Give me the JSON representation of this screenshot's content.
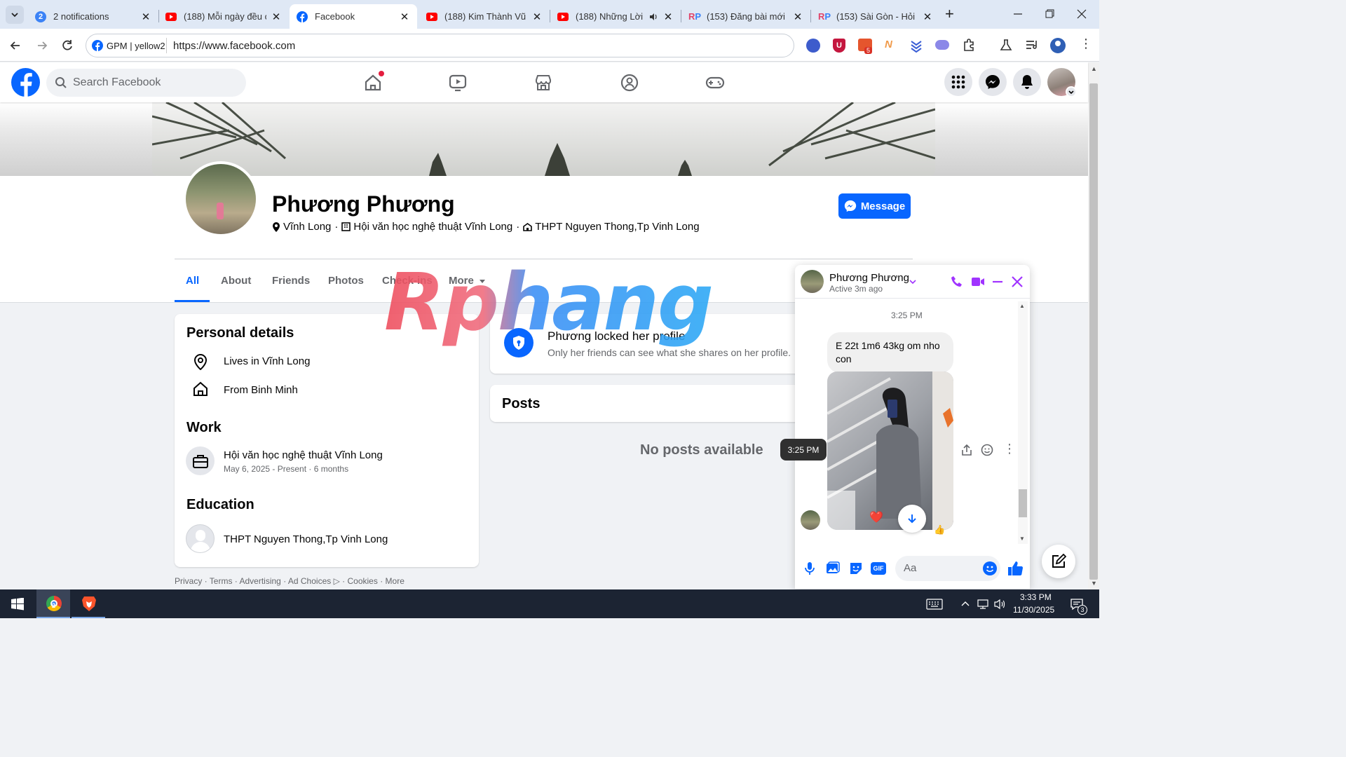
{
  "browser": {
    "tabs": [
      {
        "title": "2 notifications",
        "icon": "notification-badge-icon"
      },
      {
        "title": "(188) Mỗi ngày đều c",
        "icon": "youtube-icon"
      },
      {
        "title": "Facebook",
        "icon": "facebook-icon",
        "active": true
      },
      {
        "title": "(188) Kim Thành Vũ ·",
        "icon": "youtube-icon"
      },
      {
        "title": "(188) Những Lời",
        "icon": "youtube-icon"
      },
      {
        "title": "(153) Đăng bài mới |",
        "icon": "rp-icon"
      },
      {
        "title": "(153) Sài Gòn - Hỏi ·",
        "icon": "rp-icon"
      }
    ],
    "tab_badge": "2",
    "profile_chip": "GPM | yellow2",
    "url": "https://www.facebook.com",
    "extension_badge": "5"
  },
  "fb": {
    "search_placeholder": "Search Facebook",
    "profile": {
      "name": "Phương Phương",
      "location": "Vĩnh Long",
      "work_short": "Hội văn học nghệ thuật Vĩnh Long",
      "school_short": "THPT Nguyen Thong,Tp Vinh Long",
      "message_button": "Message"
    },
    "tabs": [
      "All",
      "About",
      "Friends",
      "Photos",
      "Check-ins",
      "More"
    ],
    "personal": {
      "title": "Personal details",
      "lives": "Lives in Vĩnh Long",
      "from": "From Binh Minh"
    },
    "work": {
      "title": "Work",
      "org": "Hội văn học nghệ thuật Vĩnh Long",
      "dates": "May 6, 2025 - Present · 6 months"
    },
    "education": {
      "title": "Education",
      "school": "THPT Nguyen Thong,Tp Vinh Long"
    },
    "footer": [
      "Privacy",
      "Terms",
      "Advertising",
      "Ad Choices",
      "Cookies",
      "More"
    ],
    "locked": {
      "title": "Phương locked her profile",
      "subtitle": "Only her friends can see what she shares on her profile."
    },
    "posts_title": "Posts",
    "no_posts": "No posts available"
  },
  "watermark": "Rphang",
  "chat": {
    "name": "Phương Phương",
    "status": "Active 3m ago",
    "time_header": "3:25 PM",
    "message": "E 22t 1m6 43kg om nho con",
    "tooltip_time": "3:25 PM",
    "input_placeholder": "Aa",
    "reactions": [
      "❤️",
      "👍"
    ]
  },
  "taskbar": {
    "time": "3:33 PM",
    "date": "11/30/2025",
    "chrome_badge": "2",
    "notif_count": "3"
  },
  "colors": {
    "fb_blue": "#0866ff",
    "messenger_purple": "#a033ff",
    "text_secondary": "#65676b"
  }
}
